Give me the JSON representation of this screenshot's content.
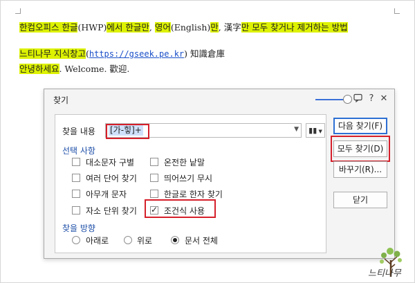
{
  "document": {
    "line1": {
      "seg1": "한컴오피스 한글",
      "seg2": "(HWP)",
      "seg3": "에서 한글만",
      "seg4": ", ",
      "seg5": "영어",
      "seg6": "(English)",
      "seg7": "만",
      "seg8": ", 漢字",
      "seg9": "만 모두 찾거나 제거하는 방법"
    },
    "line2": {
      "name": "느티나무 지식창고",
      "paren_open": "(",
      "url": "https://gseek.pe.kr",
      "paren_close": ")",
      "hanja": " 知識倉庫"
    },
    "line3": {
      "greeting": "안녕하세요",
      "rest": ". Welcome. 歡迎."
    }
  },
  "dialog": {
    "title": "찾기",
    "titlebar_icons": [
      "zoom-slider",
      "chat-icon",
      "help-icon",
      "close-icon"
    ],
    "help_glyph": "?",
    "close_glyph": "✕",
    "find_label": "찾을 내용",
    "find_value": "[가-힣]+",
    "options_header": "선택 사항",
    "options": [
      {
        "label": "대소문자 구별",
        "checked": false
      },
      {
        "label": "온전한 낱말",
        "checked": false
      },
      {
        "label": "여러 단어 찾기",
        "checked": false
      },
      {
        "label": "띄어쓰기 무시",
        "checked": false
      },
      {
        "label": "아무개 문자",
        "checked": false
      },
      {
        "label": "한글로 한자 찾기",
        "checked": false
      },
      {
        "label": "자소 단위 찾기",
        "checked": false
      },
      {
        "label": "조건식 사용",
        "checked": true
      }
    ],
    "direction_header": "찾을 방향",
    "directions": [
      {
        "label": "아래로",
        "selected": false
      },
      {
        "label": "위로",
        "selected": false
      },
      {
        "label": "문서 전체",
        "selected": true
      }
    ],
    "buttons": {
      "find_next": "다음 찾기(F)",
      "find_all": "모두 찾기(D)",
      "replace": "바꾸기(R)...",
      "close": "닫기"
    }
  },
  "logo": {
    "text": "느티나무"
  },
  "colors": {
    "highlight": "#ddf200",
    "annotation_red": "#d51f2a",
    "link": "#1a4fc8",
    "section_header": "#1e4fa8",
    "primary_button_border": "#2d6fd3"
  }
}
